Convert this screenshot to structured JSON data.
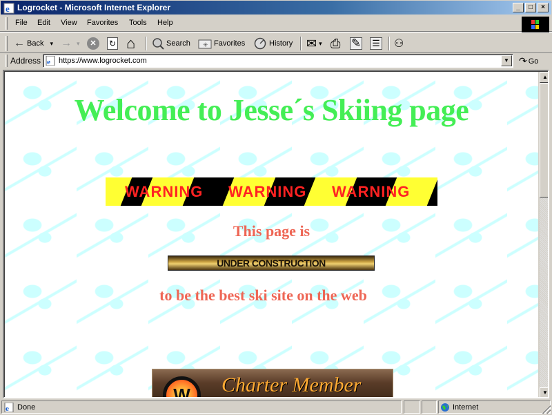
{
  "window": {
    "title": "Logrocket - Microsoft Internet Explorer",
    "controls": [
      "_",
      "□",
      "×"
    ]
  },
  "menu": {
    "items": [
      {
        "label": "File",
        "accel": "F"
      },
      {
        "label": "Edit",
        "accel": "E"
      },
      {
        "label": "View",
        "accel": "V"
      },
      {
        "label": "Favorites",
        "accel": "a"
      },
      {
        "label": "Tools",
        "accel": "T"
      },
      {
        "label": "Help",
        "accel": "H"
      }
    ]
  },
  "toolbar": {
    "back_label": "Back",
    "search_label": "Search",
    "favorites_label": "Favorites",
    "history_label": "History",
    "icons": {
      "back": "←",
      "forward": "→",
      "dropdown": "▾",
      "stop": "✕",
      "refresh": "↻",
      "home": "⌂",
      "mail": "✉",
      "print": "⎙",
      "edit": "✎",
      "discuss": "☰",
      "messenger": "⚇"
    }
  },
  "address": {
    "label": "Address",
    "url": "https://www.logrocket.com",
    "go_label": "Go",
    "dropdown": "▼"
  },
  "page": {
    "heading": "Welcome to Jesse´s Skiing page",
    "warning_words": [
      "WARNING",
      "WARNING",
      "WARNING"
    ],
    "line1": "This page is",
    "under_construction": "UNDER CONSTRUCTION",
    "line2": "to be the best ski site on the web",
    "charter_logo": "W",
    "charter_text": "Charter Member"
  },
  "scrollbar": {
    "up": "▲",
    "down": "▼"
  },
  "status": {
    "text": "Done",
    "zone": "Internet"
  },
  "colors": {
    "heading": "#44ee55",
    "subtext": "#ee6655",
    "warning_text": "#ff2222",
    "warning_stripe": "#ffff33",
    "background_pattern": "#ccffff"
  }
}
